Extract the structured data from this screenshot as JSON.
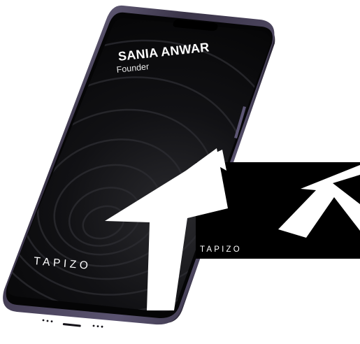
{
  "profile": {
    "name": "SANIA ANWAR",
    "title": "Founder"
  },
  "phone": {
    "brand_text": "TAPIZO",
    "frame_color": "#2f2a3a",
    "frame_highlight_color": "#8b84a6",
    "screen_color": "#0b0b0d"
  },
  "card": {
    "brand_text": "TAPIZO",
    "card_color": "#000000",
    "logo_color": "#ffffff"
  },
  "logo_icon": "tapizo-t-logo-icon"
}
